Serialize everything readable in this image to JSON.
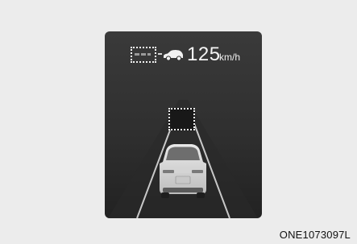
{
  "display": {
    "speed_value": "125",
    "speed_unit": "km/h",
    "icons": [
      "distance-level-indicator",
      "lead-vehicle-icon",
      "target-vehicle-indicator",
      "own-vehicle"
    ]
  },
  "caption": "ONE1073097L",
  "colors": {
    "page_background": "#ececec",
    "display_background": "#2f2f2f",
    "indicator": "#f2f2f2"
  }
}
